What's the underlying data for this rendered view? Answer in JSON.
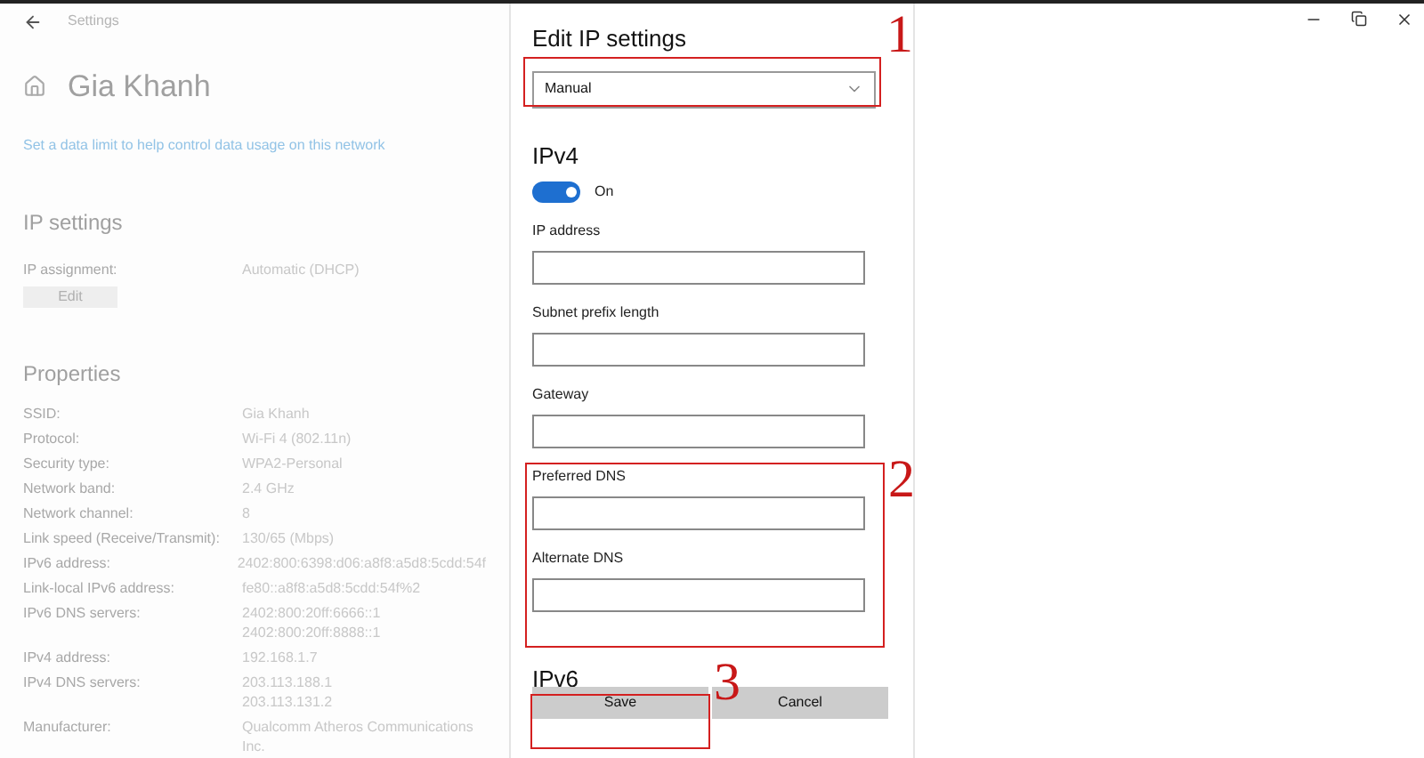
{
  "window": {
    "title": "Settings"
  },
  "page_title": "Gia Khanh",
  "data_limit_link": "Set a data limit to help control data usage on this network",
  "ip_settings": {
    "heading": "IP settings",
    "assignment_label": "IP assignment:",
    "assignment_value": "Automatic (DHCP)",
    "edit_button": "Edit"
  },
  "properties": {
    "heading": "Properties",
    "rows": [
      {
        "label": "SSID:",
        "values": [
          "Gia Khanh"
        ]
      },
      {
        "label": "Protocol:",
        "values": [
          "Wi-Fi 4 (802.11n)"
        ]
      },
      {
        "label": "Security type:",
        "values": [
          "WPA2-Personal"
        ]
      },
      {
        "label": "Network band:",
        "values": [
          "2.4 GHz"
        ]
      },
      {
        "label": "Network channel:",
        "values": [
          "8"
        ]
      },
      {
        "label": "Link speed (Receive/Transmit):",
        "values": [
          "130/65 (Mbps)"
        ]
      },
      {
        "label": "IPv6 address:",
        "values": [
          "2402:800:6398:d06:a8f8:a5d8:5cdd:54f"
        ]
      },
      {
        "label": "Link-local IPv6 address:",
        "values": [
          "fe80::a8f8:a5d8:5cdd:54f%2"
        ]
      },
      {
        "label": "IPv6 DNS servers:",
        "values": [
          "2402:800:20ff:6666::1",
          "2402:800:20ff:8888::1"
        ]
      },
      {
        "label": "IPv4 address:",
        "values": [
          "192.168.1.7"
        ]
      },
      {
        "label": "IPv4 DNS servers:",
        "values": [
          "203.113.188.1",
          "203.113.131.2"
        ]
      },
      {
        "label": "Manufacturer:",
        "values": [
          "Qualcomm Atheros Communications",
          "Inc."
        ]
      }
    ]
  },
  "dialog": {
    "title": "Edit IP settings",
    "mode_select": {
      "value": "Manual"
    },
    "ipv4": {
      "heading": "IPv4",
      "toggle": {
        "on": true,
        "label": "On"
      },
      "fields": [
        {
          "label": "IP address"
        },
        {
          "label": "Subnet prefix length"
        },
        {
          "label": "Gateway"
        },
        {
          "label": "Preferred DNS"
        },
        {
          "label": "Alternate DNS"
        }
      ]
    },
    "ipv6_heading": "IPv6",
    "buttons": [
      {
        "label": "Save"
      },
      {
        "label": "Cancel"
      }
    ]
  },
  "annotations": [
    {
      "label": "1"
    },
    {
      "label": "2"
    },
    {
      "label": "3"
    }
  ]
}
